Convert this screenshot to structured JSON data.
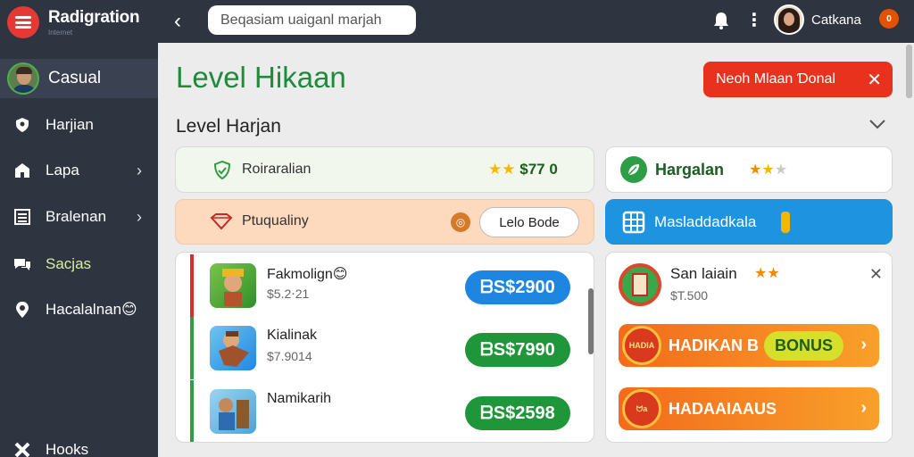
{
  "app": {
    "title": "Radigration",
    "subtitle": "Internet"
  },
  "sidebar": {
    "profile_name": "Casual",
    "items": [
      {
        "label": "Harjian",
        "icon": "shield-icon",
        "chevron": false
      },
      {
        "label": "Lapa",
        "icon": "store-icon",
        "chevron": true
      },
      {
        "label": "Bralenan",
        "icon": "list-icon",
        "chevron": true
      },
      {
        "label": "Sacjas",
        "icon": "chat-icon",
        "chevron": false,
        "active": true
      },
      {
        "label": "Hacalalnan😊",
        "icon": "pin-icon",
        "chevron": false
      },
      {
        "label": "Hooks",
        "icon": "x-icon",
        "chevron": false
      }
    ]
  },
  "topbar": {
    "back": "‹",
    "search_text": "Beqasiam uaiganl marjah",
    "kebab": "⋮",
    "user_name": "Catkana",
    "user_badge": "0"
  },
  "main": {
    "page_title": "Level Hikaan",
    "alert_text": "Neoh Mlaan Ɗonal",
    "alert_close": "✕",
    "section_title": "Level Harjan",
    "row1_left": {
      "label": "Roiraralian",
      "rating_text": "$77 0"
    },
    "row1_right": {
      "label": "Hargalan"
    },
    "row2_left": {
      "label": "Ptuqualiny",
      "badge": "◎",
      "button": "Lelo Bode"
    },
    "row2_right": {
      "label": "Masladdadkala"
    }
  },
  "list": {
    "items": [
      {
        "name": "Fakmolign😊",
        "price": "$5.2⋅21",
        "button": "ᗷS$2900",
        "button_color": "#1e86e0",
        "accent": "#d32f2f"
      },
      {
        "name": "Kialinak",
        "price": "$7.9014",
        "button": "ᗷS$7990",
        "button_color": "#20963a",
        "accent": "#2e9e46"
      },
      {
        "name": "Namikarih",
        "price": "",
        "button": "ᗷS$2598",
        "button_color": "#20963a",
        "accent": "#2e9e46"
      }
    ]
  },
  "side_panel": {
    "title": "San laiain",
    "price": "$T.500",
    "close": "✕",
    "promo1": {
      "text": "HADIKAN B",
      "bonus": "BONUS",
      "badge": "HADIA"
    },
    "promo2": {
      "text": "HADAAIAAUS",
      "badge": "ᗢa"
    }
  },
  "colors": {
    "accent": "#1e8a3c",
    "alert": "#e8321e",
    "sidebar": "#2e3440",
    "blue": "#1e94e0"
  }
}
